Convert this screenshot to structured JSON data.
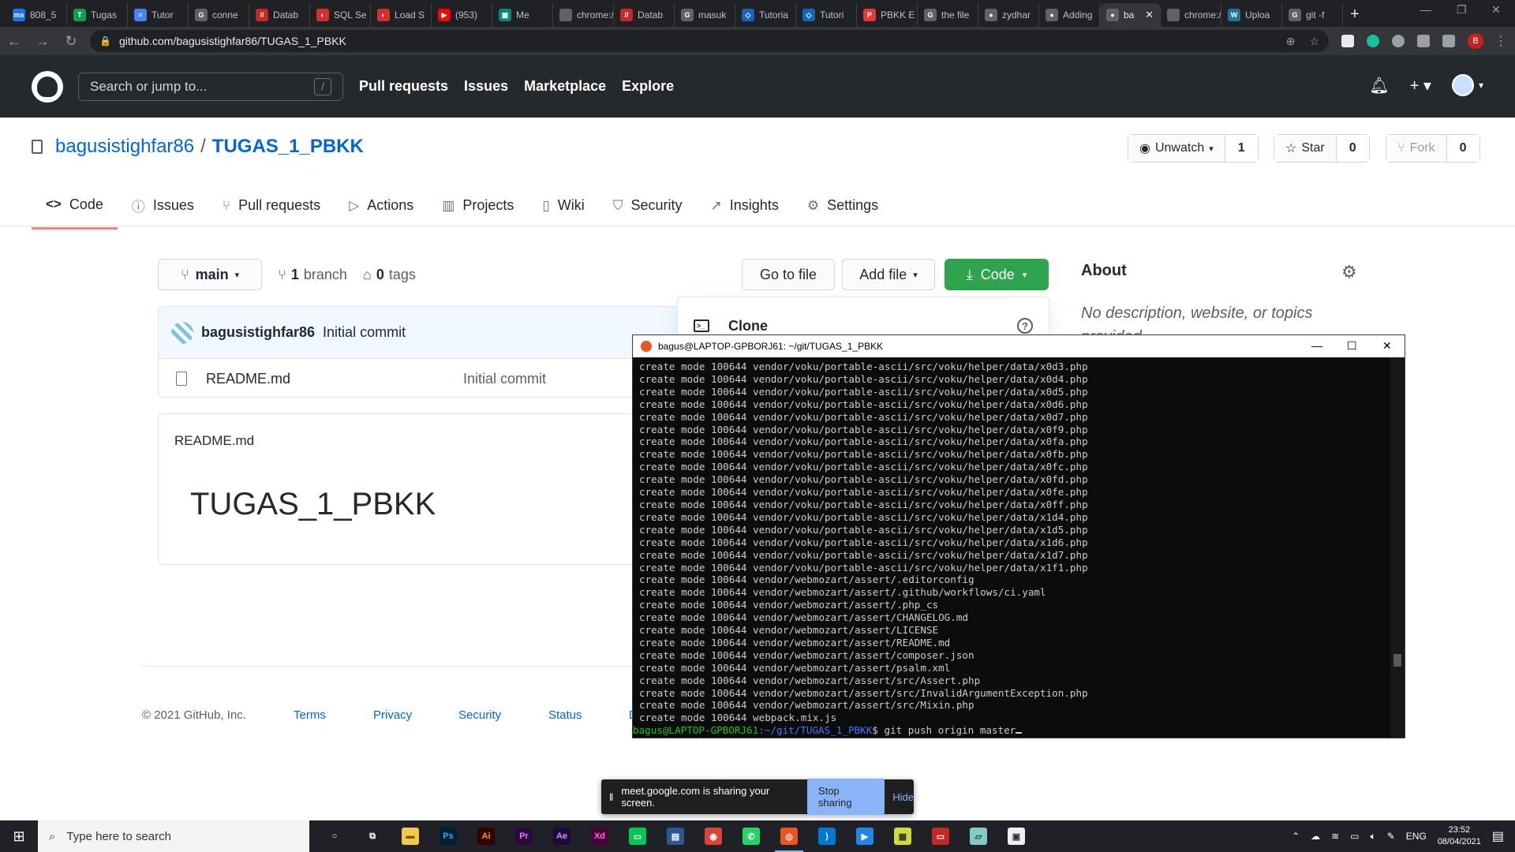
{
  "browser": {
    "tabs": [
      {
        "label": "808_5",
        "color": "#1a73e8",
        "glyph": "ms"
      },
      {
        "label": "Tugas",
        "color": "#0f9d58",
        "glyph": "T"
      },
      {
        "label": "Tutor",
        "color": "#4285f4",
        "glyph": "≡"
      },
      {
        "label": "conne",
        "color": "#5f6368",
        "glyph": "G"
      },
      {
        "label": "Datab",
        "color": "#c62828",
        "glyph": "//"
      },
      {
        "label": "SQL Se",
        "color": "#d32f2f",
        "glyph": "◐"
      },
      {
        "label": "Load S",
        "color": "#d32f2f",
        "glyph": "◐"
      },
      {
        "label": "(953)",
        "color": "#ff0000",
        "glyph": "▶"
      },
      {
        "label": "Me",
        "color": "#00897b",
        "glyph": "▣"
      },
      {
        "label": "chrome://n",
        "color": "#5f6368",
        "glyph": ""
      },
      {
        "label": "Datab",
        "color": "#c62828",
        "glyph": "//"
      },
      {
        "label": "masuk",
        "color": "#5f6368",
        "glyph": "G"
      },
      {
        "label": "Tutoria",
        "color": "#1565c0",
        "glyph": "◇"
      },
      {
        "label": "Tutori",
        "color": "#1565c0",
        "glyph": "◇"
      },
      {
        "label": "PBKK E",
        "color": "#e53935",
        "glyph": "P"
      },
      {
        "label": "the file",
        "color": "#5f6368",
        "glyph": "G"
      },
      {
        "label": "zydhar",
        "color": "#5f6368",
        "glyph": "●"
      },
      {
        "label": "Adding",
        "color": "#5f6368",
        "glyph": "●"
      },
      {
        "label": "ba",
        "color": "#5f6368",
        "glyph": "●",
        "active": true
      },
      {
        "label": "chrome://n",
        "color": "#5f6368",
        "glyph": ""
      },
      {
        "label": "Uploa",
        "color": "#21759b",
        "glyph": "W"
      },
      {
        "label": "git -f",
        "color": "#5f6368",
        "glyph": "G"
      }
    ],
    "url": "github.com/bagusistighfar86/TUGAS_1_PBKK",
    "profile_initial": "B"
  },
  "header": {
    "search_placeholder": "Search or jump to...",
    "search_shortcut": "/",
    "nav": [
      "Pull requests",
      "Issues",
      "Marketplace",
      "Explore"
    ]
  },
  "repo": {
    "owner": "bagusistighfar86",
    "separator": "/",
    "name": "TUGAS_1_PBKK",
    "unwatch_label": "Unwatch",
    "watch_count": "1",
    "star_label": "Star",
    "star_count": "0",
    "fork_label": "Fork",
    "fork_count": "0",
    "tabs": [
      {
        "label": "Code",
        "icon": "<>"
      },
      {
        "label": "Issues",
        "icon": "ⓘ"
      },
      {
        "label": "Pull requests",
        "icon": "⑂"
      },
      {
        "label": "Actions",
        "icon": "▷"
      },
      {
        "label": "Projects",
        "icon": "▥"
      },
      {
        "label": "Wiki",
        "icon": "▯"
      },
      {
        "label": "Security",
        "icon": "⛉"
      },
      {
        "label": "Insights",
        "icon": "↗"
      },
      {
        "label": "Settings",
        "icon": "⚙"
      }
    ]
  },
  "filenav": {
    "branch": "main",
    "branch_count": "1",
    "branch_word": "branch",
    "tag_count": "0",
    "tag_word": "tags",
    "go_to_file": "Go to file",
    "add_file": "Add file",
    "code": "Code"
  },
  "commit": {
    "author": "bagusistighfar86",
    "message": "Initial commit"
  },
  "files": [
    {
      "name": "README.md",
      "message": "Initial commit"
    }
  ],
  "readme": {
    "title": "README.md",
    "heading": "TUGAS_1_PBKK"
  },
  "clone": {
    "label": "Clone",
    "help": "?"
  },
  "about": {
    "title": "About",
    "description": "No description, website, or topics provided."
  },
  "footer": {
    "copyright": "© 2021 GitHub, Inc.",
    "links": [
      "Terms",
      "Privacy",
      "Security",
      "Status"
    ],
    "cut_link": "D"
  },
  "terminal": {
    "title": "bagus@LAPTOP-GPBORJ61: ~/git/TUGAS_1_PBKK",
    "lines": [
      "create mode 100644 vendor/voku/portable-ascii/src/voku/helper/data/x0d3.php",
      "create mode 100644 vendor/voku/portable-ascii/src/voku/helper/data/x0d4.php",
      "create mode 100644 vendor/voku/portable-ascii/src/voku/helper/data/x0d5.php",
      "create mode 100644 vendor/voku/portable-ascii/src/voku/helper/data/x0d6.php",
      "create mode 100644 vendor/voku/portable-ascii/src/voku/helper/data/x0d7.php",
      "create mode 100644 vendor/voku/portable-ascii/src/voku/helper/data/x0f9.php",
      "create mode 100644 vendor/voku/portable-ascii/src/voku/helper/data/x0fa.php",
      "create mode 100644 vendor/voku/portable-ascii/src/voku/helper/data/x0fb.php",
      "create mode 100644 vendor/voku/portable-ascii/src/voku/helper/data/x0fc.php",
      "create mode 100644 vendor/voku/portable-ascii/src/voku/helper/data/x0fd.php",
      "create mode 100644 vendor/voku/portable-ascii/src/voku/helper/data/x0fe.php",
      "create mode 100644 vendor/voku/portable-ascii/src/voku/helper/data/x0ff.php",
      "create mode 100644 vendor/voku/portable-ascii/src/voku/helper/data/x1d4.php",
      "create mode 100644 vendor/voku/portable-ascii/src/voku/helper/data/x1d5.php",
      "create mode 100644 vendor/voku/portable-ascii/src/voku/helper/data/x1d6.php",
      "create mode 100644 vendor/voku/portable-ascii/src/voku/helper/data/x1d7.php",
      "create mode 100644 vendor/voku/portable-ascii/src/voku/helper/data/x1f1.php",
      "create mode 100644 vendor/webmozart/assert/.editorconfig",
      "create mode 100644 vendor/webmozart/assert/.github/workflows/ci.yaml",
      "create mode 100644 vendor/webmozart/assert/.php_cs",
      "create mode 100644 vendor/webmozart/assert/CHANGELOG.md",
      "create mode 100644 vendor/webmozart/assert/LICENSE",
      "create mode 100644 vendor/webmozart/assert/README.md",
      "create mode 100644 vendor/webmozart/assert/composer.json",
      "create mode 100644 vendor/webmozart/assert/psalm.xml",
      "create mode 100644 vendor/webmozart/assert/src/Assert.php",
      "create mode 100644 vendor/webmozart/assert/src/InvalidArgumentException.php",
      "create mode 100644 vendor/webmozart/assert/src/Mixin.php",
      "create mode 100644 webpack.mix.js"
    ],
    "prompt_user": "bagus@LAPTOP-GPBORJ61",
    "prompt_path": ":~/git/TUGAS_1_PBKK",
    "prompt_command": "$ git push origin master"
  },
  "share_bar": {
    "text": "meet.google.com is sharing your screen.",
    "stop": "Stop sharing",
    "hide": "Hide"
  },
  "taskbar": {
    "search_placeholder": "Type here to search",
    "apps": [
      {
        "name": "cortana-icon",
        "label": "",
        "bg": "transparent",
        "fg": "#fff",
        "glyph": "○"
      },
      {
        "name": "task-view-icon",
        "label": "",
        "bg": "transparent",
        "fg": "#fff",
        "glyph": "⧉"
      },
      {
        "name": "file-explorer-icon",
        "label": "",
        "bg": "#f2c94c",
        "fg": "#7a5c00",
        "glyph": "▬"
      },
      {
        "name": "photoshop-icon",
        "label": "Ps",
        "bg": "#001e36",
        "fg": "#31a8ff",
        "glyph": "Ps"
      },
      {
        "name": "illustrator-icon",
        "label": "Ai",
        "bg": "#330000",
        "fg": "#ff9a00",
        "glyph": "Ai"
      },
      {
        "name": "premiere-icon",
        "label": "Pr",
        "bg": "#2a0a3d",
        "fg": "#ea77ff",
        "glyph": "Pr"
      },
      {
        "name": "after-effects-icon",
        "label": "Ae",
        "bg": "#1a0b3a",
        "fg": "#d291ff",
        "glyph": "Ae"
      },
      {
        "name": "xd-icon",
        "label": "Xd",
        "bg": "#470137",
        "fg": "#ff61f6",
        "glyph": "Xd"
      },
      {
        "name": "line-icon",
        "label": "",
        "bg": "#06c755",
        "fg": "#fff",
        "glyph": "▭"
      },
      {
        "name": "dev-app-icon",
        "label": "",
        "bg": "#2b5797",
        "fg": "#fff",
        "glyph": "▤"
      },
      {
        "name": "chrome-icon",
        "label": "",
        "bg": "#db4437",
        "fg": "#fff",
        "glyph": "◉"
      },
      {
        "name": "whatsapp-icon",
        "label": "",
        "bg": "#25d366",
        "fg": "#fff",
        "glyph": "✆"
      },
      {
        "name": "ubuntu-icon",
        "label": "",
        "bg": "#e95420",
        "fg": "#fff",
        "glyph": "◎",
        "active": true
      },
      {
        "name": "vscode-icon",
        "label": "",
        "bg": "#0078d4",
        "fg": "#fff",
        "glyph": "⟩"
      },
      {
        "name": "media-icon",
        "label": "",
        "bg": "#1e88e5",
        "fg": "#fff",
        "glyph": "▶"
      },
      {
        "name": "photo-editor-icon",
        "label": "",
        "bg": "#cddc39",
        "fg": "#333",
        "glyph": "▦"
      },
      {
        "name": "document-icon",
        "label": "",
        "bg": "#c62828",
        "fg": "#fff",
        "glyph": "▭"
      },
      {
        "name": "notes-icon",
        "label": "",
        "bg": "#80cbc4",
        "fg": "#333",
        "glyph": "▱"
      },
      {
        "name": "monitor-icon",
        "label": "",
        "bg": "#eceff1",
        "fg": "#333",
        "glyph": "▣"
      }
    ],
    "lang": "ENG",
    "time": "23:52",
    "date": "08/04/2021"
  }
}
